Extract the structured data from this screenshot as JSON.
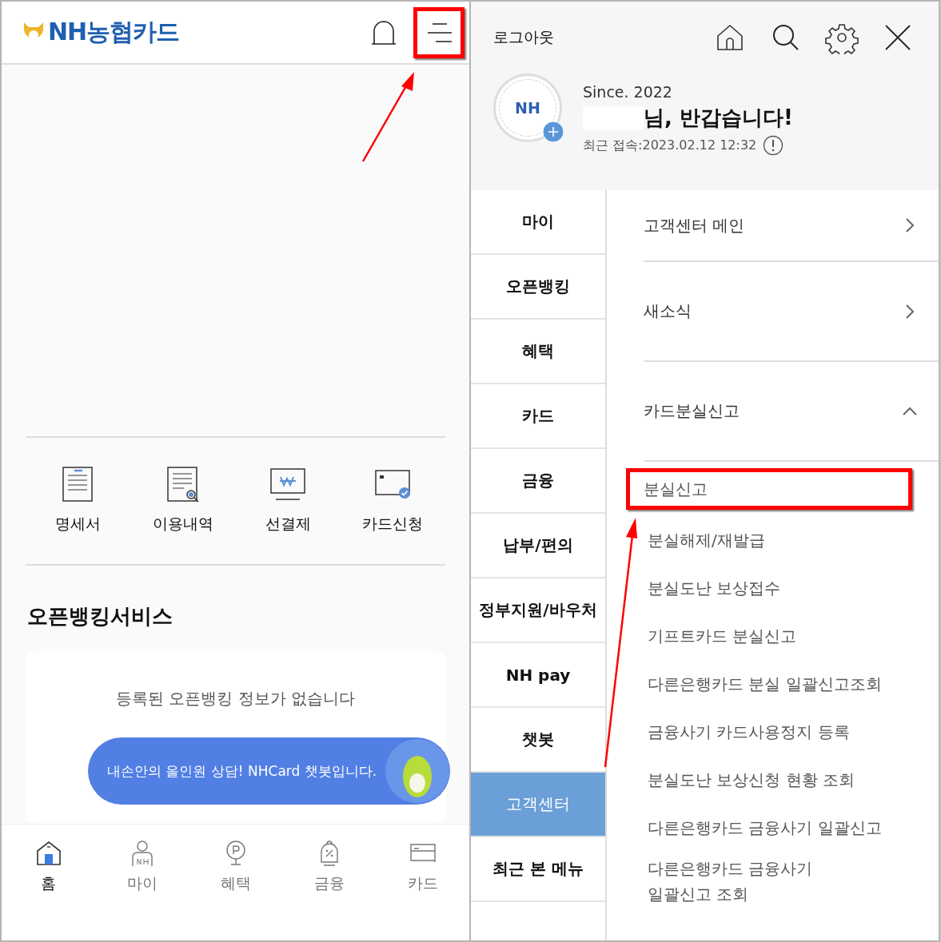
{
  "left": {
    "logo": "NH농협카드",
    "menu_button": {
      "highlighted": true
    },
    "quick_menu": [
      {
        "label": "명세서",
        "kind": "statement"
      },
      {
        "label": "이용내역",
        "kind": "history"
      },
      {
        "label": "선결제",
        "kind": "prepay"
      },
      {
        "label": "카드신청",
        "kind": "apply"
      }
    ],
    "open_banking": {
      "title": "오픈뱅킹서비스",
      "empty_message": "등록된 오픈뱅킹 정보가 없습니다"
    },
    "chatbot": {
      "message": "내손안의 올인원 상담! NHCard 챗봇입니다."
    },
    "bottom_nav": [
      {
        "label": "홈",
        "kind": "home",
        "selected": true
      },
      {
        "label": "마이",
        "kind": "my",
        "selected": false
      },
      {
        "label": "혜택",
        "kind": "benefit",
        "selected": false
      },
      {
        "label": "금융",
        "kind": "finance",
        "selected": false
      },
      {
        "label": "카드",
        "kind": "card",
        "selected": false
      }
    ]
  },
  "right": {
    "logout": "로그아웃",
    "profile": {
      "avatar": "NH",
      "since": "Since. 2022",
      "greeting": "님, 반갑습니다!",
      "last_login": "최근 접속:2023.02.12 12:32"
    },
    "categories": [
      {
        "label": "마이",
        "selected": false
      },
      {
        "label": "오픈뱅킹",
        "selected": false
      },
      {
        "label": "혜택",
        "selected": false
      },
      {
        "label": "카드",
        "selected": false
      },
      {
        "label": "금융",
        "selected": false
      },
      {
        "label": "납부/편의",
        "selected": false
      },
      {
        "label": "정부지원/바우처",
        "selected": false
      },
      {
        "label": "NH pay",
        "selected": false
      },
      {
        "label": "챗봇",
        "selected": false
      },
      {
        "label": "고객센터",
        "selected": true
      },
      {
        "label": "최근 본 메뉴",
        "selected": false
      }
    ],
    "menu": [
      {
        "label": "고객센터 메인",
        "kind": "link"
      },
      {
        "label": "새소식",
        "kind": "link"
      },
      {
        "label": "카드분실신고",
        "kind": "group",
        "expanded": true,
        "children": [
          {
            "label": "분실신고",
            "highlighted": true
          },
          {
            "label": "분실해제/재발급",
            "highlighted": false
          },
          {
            "label": "분실도난 보상접수",
            "highlighted": false
          },
          {
            "label": "기프트카드 분실신고",
            "highlighted": false
          },
          {
            "label": "다른은행카드 분실 일괄신고조회",
            "highlighted": false
          },
          {
            "label": "금융사기 카드사용정지 등록",
            "highlighted": false
          },
          {
            "label": "분실도난 보상신청 현황 조회",
            "highlighted": false
          },
          {
            "label": "다른은행카드 금융사기 일괄신고",
            "highlighted": false
          },
          {
            "label": "다른은행카드 금융사기 일괄신고 조회",
            "highlighted": false
          }
        ]
      }
    ]
  }
}
